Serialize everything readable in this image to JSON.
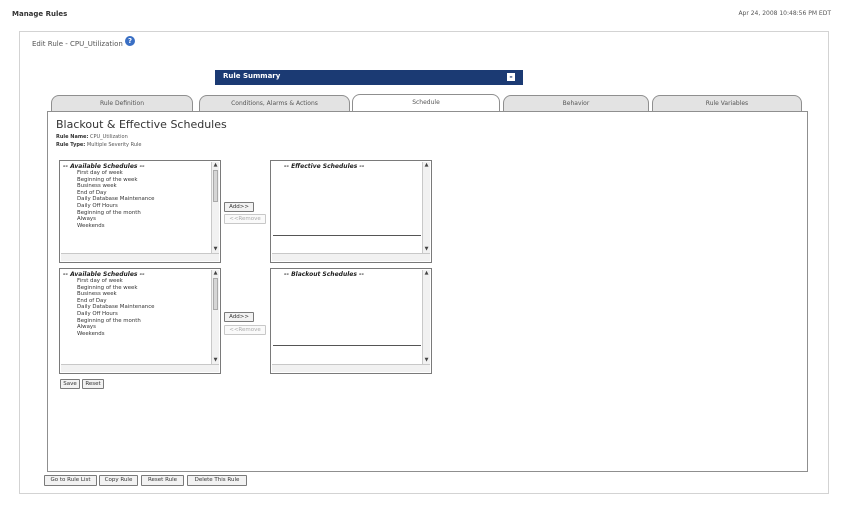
{
  "header": {
    "page_title": "Manage Rules",
    "timestamp": "Apr 24, 2008 10:48:56 PM EDT"
  },
  "rule": {
    "edit_label": "Edit Rule - CPU_Utilization",
    "summary_title": "Rule Summary",
    "summary_toggle": "-"
  },
  "tabs": [
    {
      "label": "Rule Definition"
    },
    {
      "label": "Conditions, Alarms & Actions"
    },
    {
      "label": "Schedule"
    },
    {
      "label": "Behavior"
    },
    {
      "label": "Rule Variables"
    }
  ],
  "schedules": {
    "heading": "Blackout & Effective Schedules",
    "rule_name_label": "Rule Name:",
    "rule_name_value": "CPU_Utilization",
    "rule_type_label": "Rule Type:",
    "rule_type_value": "Multiple Severity Rule",
    "available_header": "-- Available Schedules --",
    "available_items": [
      "First day of week",
      "Beginning of the week",
      "Business week",
      "End of Day",
      "Daily Database Maintenance",
      "Daily Off Hours",
      "Beginning of the month",
      "Always",
      "Weekends"
    ],
    "effective_header": "-- Effective Schedules --",
    "blackout_header": "-- Blackout Schedules --",
    "add_label": "Add>>",
    "remove_label": "<<Remove",
    "save_label": "Save",
    "reset_label": "Reset"
  },
  "bottom_buttons": {
    "go_to_rule_list": "Go to Rule List",
    "copy_rule": "Copy Rule",
    "reset_rule": "Reset Rule",
    "delete_rule": "Delete This Rule"
  },
  "colors": {
    "summary_bar": "#1b3a73",
    "help_icon": "#3a6fc4"
  }
}
